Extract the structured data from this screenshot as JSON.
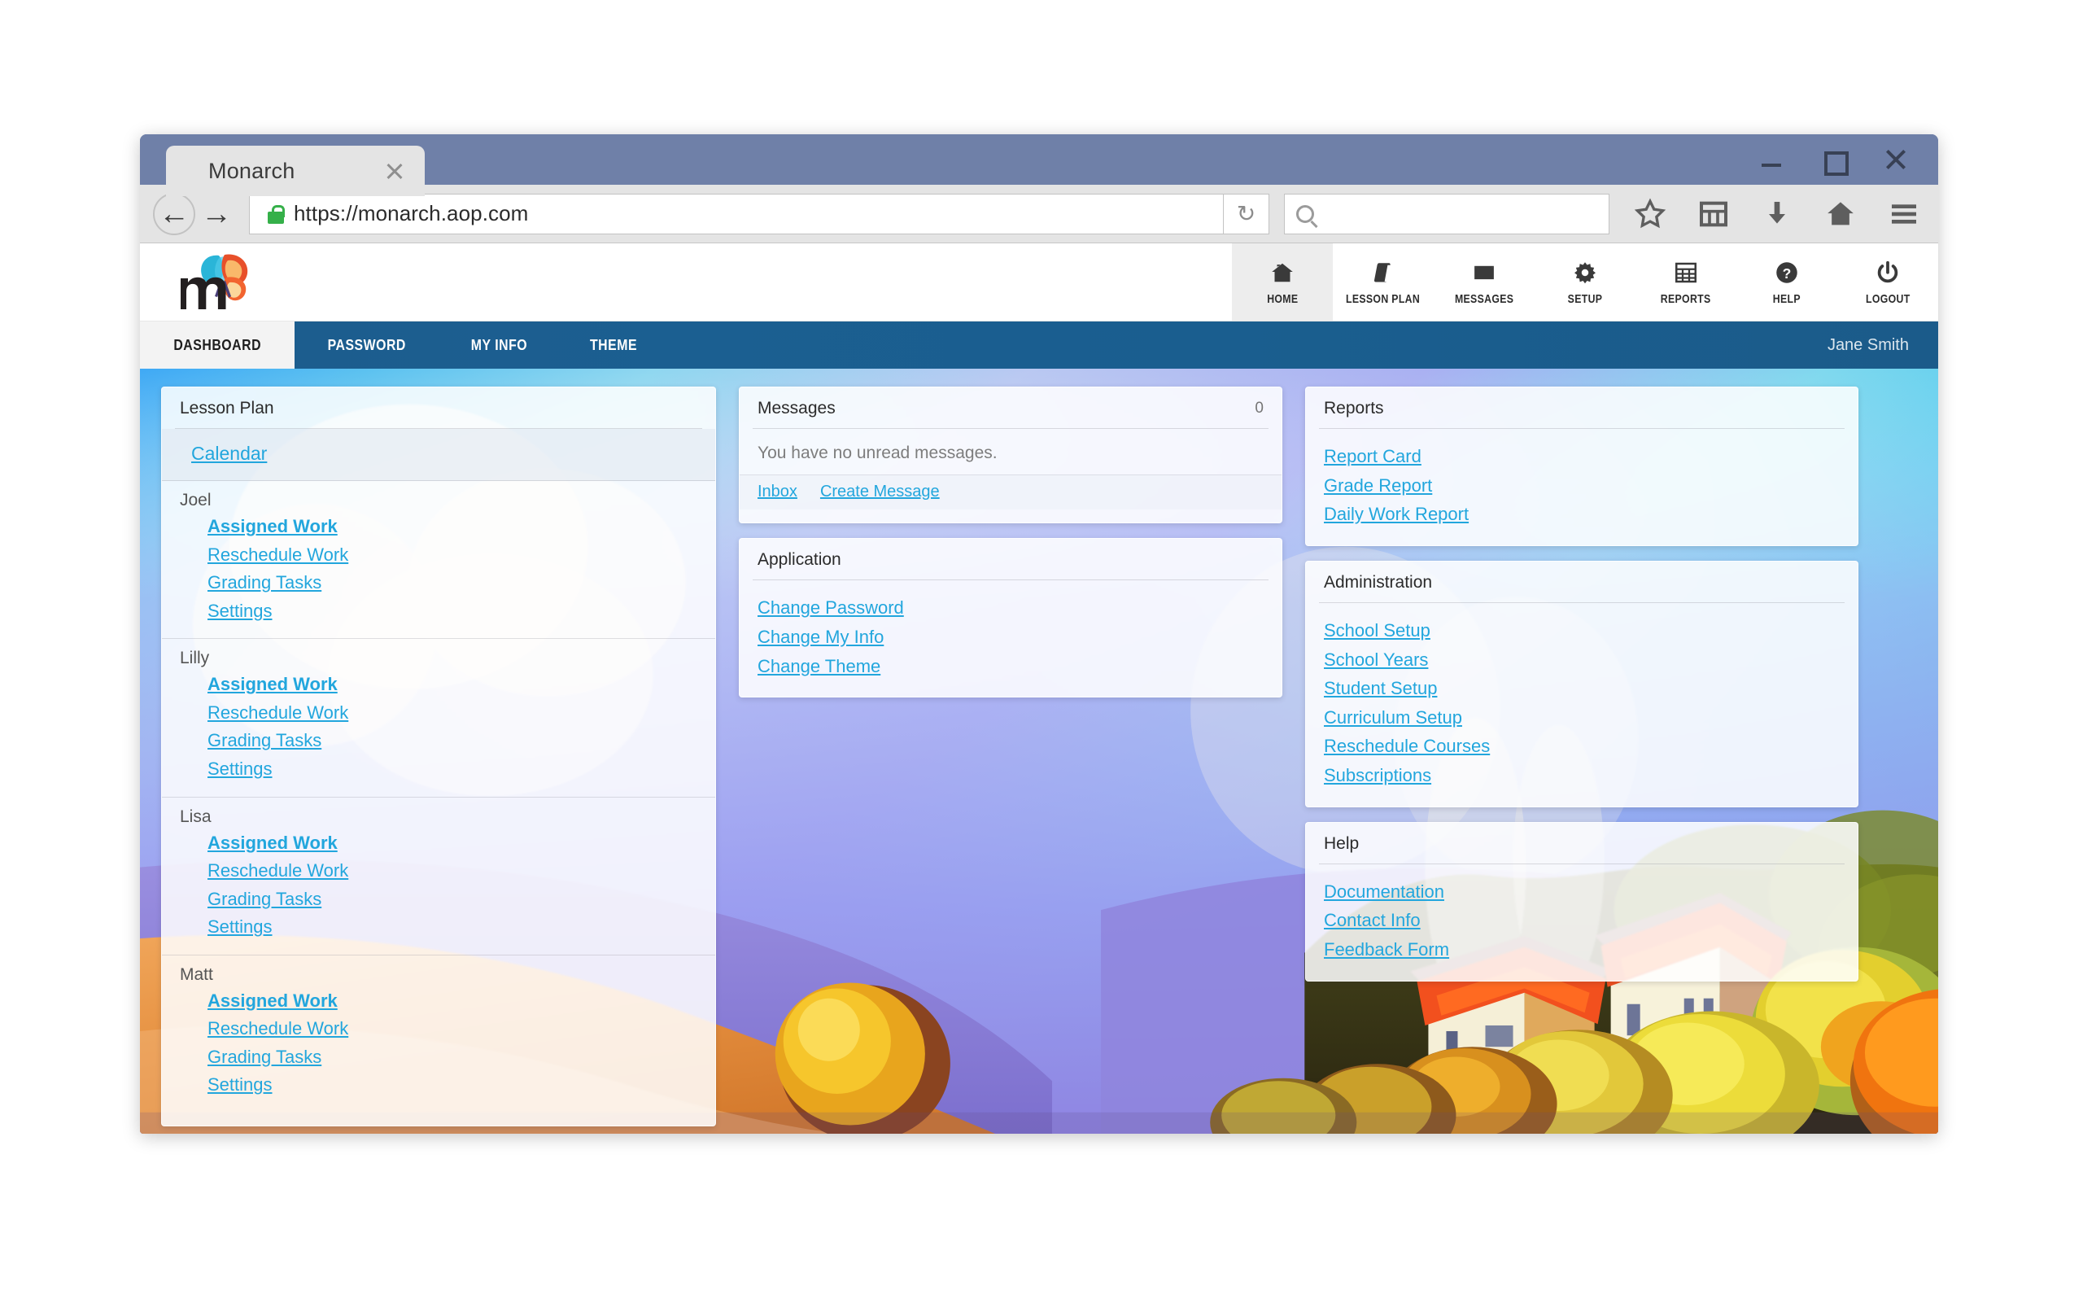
{
  "browser": {
    "tab_title": "Monarch",
    "url": "https://monarch.aop.com",
    "search_placeholder": "",
    "search_value": "",
    "icons": {
      "back": "back-arrow-icon",
      "forward": "forward-arrow-icon",
      "lock": "lock-icon",
      "reload": "reload-icon",
      "search": "search-icon",
      "bookmark": "star-icon",
      "library": "grid-library-icon",
      "downloads": "download-arrow-icon",
      "home": "home-icon",
      "menu": "hamburger-menu-icon"
    },
    "window_controls": {
      "minimize": "minimize-icon",
      "maximize": "maximize-icon",
      "close": "close-icon"
    }
  },
  "app": {
    "logo_alt": "monarch-butterfly-logo",
    "user_name": "Jane Smith",
    "main_nav": [
      {
        "label": "HOME",
        "icon": "home-icon",
        "active": true
      },
      {
        "label": "LESSON PLAN",
        "icon": "book-icon",
        "active": false
      },
      {
        "label": "MESSAGES",
        "icon": "envelope-icon",
        "active": false
      },
      {
        "label": "SETUP",
        "icon": "gear-icon",
        "active": false
      },
      {
        "label": "REPORTS",
        "icon": "grid-icon",
        "active": false
      },
      {
        "label": "HELP",
        "icon": "question-icon",
        "active": false
      },
      {
        "label": "LOGOUT",
        "icon": "power-icon",
        "active": false
      }
    ],
    "sub_nav": [
      {
        "label": "DASHBOARD",
        "active": true
      },
      {
        "label": "PASSWORD",
        "active": false
      },
      {
        "label": "MY INFO",
        "active": false
      },
      {
        "label": "THEME",
        "active": false
      }
    ]
  },
  "dashboard": {
    "lesson_plan": {
      "title": "Lesson Plan",
      "calendar_link": "Calendar",
      "students": [
        {
          "name": "Joel",
          "links": [
            "Assigned Work",
            "Reschedule Work",
            "Grading Tasks",
            "Settings"
          ]
        },
        {
          "name": "Lilly",
          "links": [
            "Assigned Work",
            "Reschedule Work",
            "Grading Tasks",
            "Settings"
          ]
        },
        {
          "name": "Lisa",
          "links": [
            "Assigned Work",
            "Reschedule Work",
            "Grading Tasks",
            "Settings"
          ]
        },
        {
          "name": "Matt",
          "links": [
            "Assigned Work",
            "Reschedule Work",
            "Grading Tasks",
            "Settings"
          ]
        }
      ]
    },
    "messages": {
      "title": "Messages",
      "count": "0",
      "empty_text": "You have no unread messages.",
      "actions": [
        "Inbox",
        "Create Message"
      ]
    },
    "application": {
      "title": "Application",
      "links": [
        "Change Password",
        "Change My Info",
        "Change Theme"
      ]
    },
    "reports": {
      "title": "Reports",
      "links": [
        "Report Card",
        "Grade Report",
        "Daily Work Report"
      ]
    },
    "administration": {
      "title": "Administration",
      "links": [
        "School Setup",
        "School Years",
        "Student Setup",
        "Curriculum Setup",
        "Reschedule Courses",
        "Subscriptions"
      ]
    },
    "help": {
      "title": "Help",
      "links": [
        "Documentation",
        "Contact Info",
        "Feedback Form"
      ]
    }
  },
  "colors": {
    "titlebar": "#6f80a8",
    "toolbar": "#e4e4e4",
    "subnav": "#1b5c8d",
    "link": "#22a6dd",
    "active_tab_bg": "#f3f3f3",
    "lock_green": "#35b049"
  }
}
